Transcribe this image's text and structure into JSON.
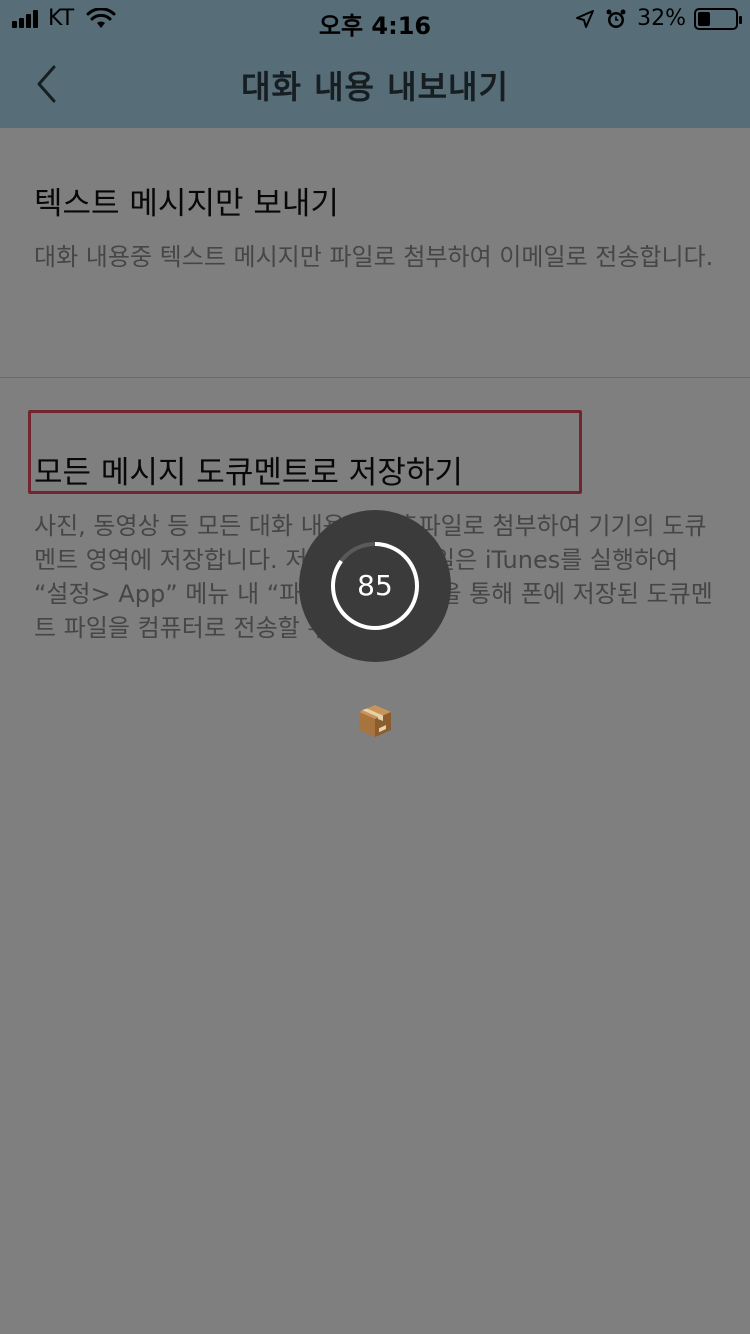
{
  "status_bar": {
    "carrier": "KT",
    "time": "오후 4:16",
    "battery_percent": "32%",
    "battery_level": 0.32,
    "icons": [
      "signal-icon",
      "wifi-icon",
      "location-arrow-icon",
      "alarm-icon",
      "battery-icon"
    ]
  },
  "nav": {
    "title": "대화 내용 내보내기",
    "back_icon": "chevron-left-icon"
  },
  "options": [
    {
      "title": "텍스트 메시지만 보내기",
      "description": "대화 내용중 텍스트 메시지만 파일로 첨부하여 이메일로 전송합니다."
    },
    {
      "title": "모든 메시지 도큐멘트로 저장하기",
      "description": "사진, 동영상 등 모든 대화 내용을 압축파일로 첨부하여 기기의 도큐멘트 영역에 저장합니다. 저장된 압축 파일은 iTunes를 실행하여 “설정> App” 메뉴 내 “파일 공유” 기능을 통해 폰에 저장된 도큐멘트 파일을 컴퓨터로 전송할 수 있습니다.",
      "highlighted": true
    }
  ],
  "progress": {
    "value": "85",
    "fraction": 0.85
  },
  "package_icon": "package-box-icon",
  "colors": {
    "header_bg": "#afdcf1",
    "highlight_border": "#e44b5e",
    "overlay": "rgba(0,0,0,0.5)",
    "hud_bg": "#3b3b3b"
  }
}
